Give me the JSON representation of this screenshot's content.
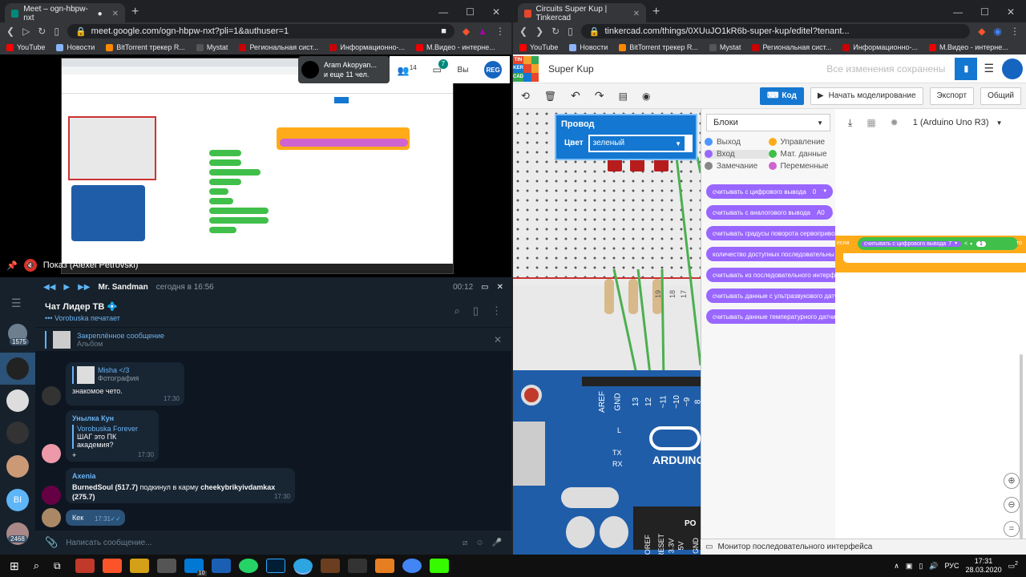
{
  "meet": {
    "tab_title": "Meet – ogn-hbpw-nxt",
    "url": "meet.google.com/ogn-hbpw-nxt?pli=1&authuser=1",
    "bookmarks": [
      "YouTube",
      "Новости",
      "BitTorrent трекер R...",
      "Mystat",
      "Региональная сист...",
      "Информационно-...",
      "М.Видео - интерне..."
    ],
    "presenter_name": "Aram Akopyan...",
    "others": "и еще 11 чел.",
    "participants_count": "14",
    "chat_count": "7",
    "you_label": "Вы",
    "badge": "REG",
    "presenting_label": "Показ (Alexei Petrovski)"
  },
  "telegram": {
    "top_name": "Mr. Sandman",
    "top_time": "сегодня в 16:56",
    "duration": "00:12",
    "chat_title": "Чат Лидер ТВ 💠",
    "typing": "••• Vorobuska печатает",
    "pinned_title": "Закреплённое сообщение",
    "pinned_sub": "Альбом",
    "sidebar_badge1": "1575",
    "sidebar_badge2": "2468",
    "sidebar_bi": "BI",
    "m1_reply_name": "Misha </3",
    "m1_reply_text": "Фотография",
    "m1_text": "знакомое чето.",
    "m1_time": "17:30",
    "m2_who": "Унылка Кун",
    "m2_reply_name": "Vorobuska Forever",
    "m2_reply_text": "ШАГ это ПК академия?",
    "m2_text": "+",
    "m2_time": "17:30",
    "m3_who": "Axenia",
    "m3_a": "BurnedSoul (517.7)",
    "m3_b": " подкинул в карму ",
    "m3_c": "cheekybrikyivdamkax",
    "m3_d": "(275.7)",
    "m3_time": "17:30",
    "m4_text": "Кек",
    "m4_time": "17:31",
    "input_placeholder": "Написать сообщение..."
  },
  "tinkercad": {
    "tab_title": "Circuits Super Kup | Tinkercad",
    "url": "tinkercad.com/things/0XUuJO1kR6b-super-kup/editel?tenant...",
    "bookmarks": [
      "YouTube",
      "Новости",
      "BitTorrent трекер R...",
      "Mystat",
      "Региональная сист...",
      "Информационно-...",
      "М.Видео - интерне..."
    ],
    "logo": [
      "TIN",
      "KER",
      "CAD"
    ],
    "project": "Super Kup",
    "saved": "Все изменения сохранены",
    "code_btn": "Код",
    "sim_btn": "Начать моделирование",
    "export_btn": "Экспорт",
    "share_btn": "Общий",
    "wire_label": "Провод",
    "color_label": "Цвет",
    "color_value": "зеленый",
    "blocks_select": "Блоки",
    "board_select": "1 (Arduino Uno R3)",
    "categories": [
      {
        "name": "Выход",
        "color": "#4c97ff"
      },
      {
        "name": "Управление",
        "color": "#ffab19"
      },
      {
        "name": "Вход",
        "color": "#9966ff"
      },
      {
        "name": "Мат. данные",
        "color": "#40bf4a"
      },
      {
        "name": "Замечание",
        "color": "#888888"
      },
      {
        "name": "Переменные",
        "color": "#cf63cf"
      }
    ],
    "blocks": [
      {
        "text": "считывать с цифрового вывода",
        "val": "0"
      },
      {
        "text": "считывать с аналогового вывода",
        "val": "A0"
      },
      {
        "text": "считывать градусы поворота сервоприво",
        "val": ""
      },
      {
        "text": "количество доступных последовательны",
        "val": ""
      },
      {
        "text": "считывать из последовательного интерф",
        "val": ""
      },
      {
        "text": "считывать данные с ультразвукового датч",
        "val": ""
      },
      {
        "text": "считывать данные температурного датчи",
        "val": ""
      }
    ],
    "code_if": "если",
    "code_read": "считывать с цифрового вывода",
    "code_pin": "7",
    "code_op": "<",
    "code_num": "1",
    "code_then": "то",
    "serial_monitor": "Монитор последовательного интерфейса",
    "board_labels": [
      "AREF",
      "GND",
      "13",
      "12",
      "~11",
      "~10",
      "~9",
      "8"
    ],
    "board_misc": [
      "L",
      "TX",
      "RX"
    ],
    "board_bottom": [
      "IOREF",
      "RESET",
      "3.3V",
      "5V",
      "GND"
    ],
    "board_word": "ARDUINO",
    "board_po": "PO",
    "breadboard_cols": [
      "19",
      "18",
      "17"
    ]
  },
  "taskbar": {
    "lang": "РУС",
    "time": "17:31",
    "date": "28.03.2020",
    "notif": "2",
    "badge10": "10"
  }
}
